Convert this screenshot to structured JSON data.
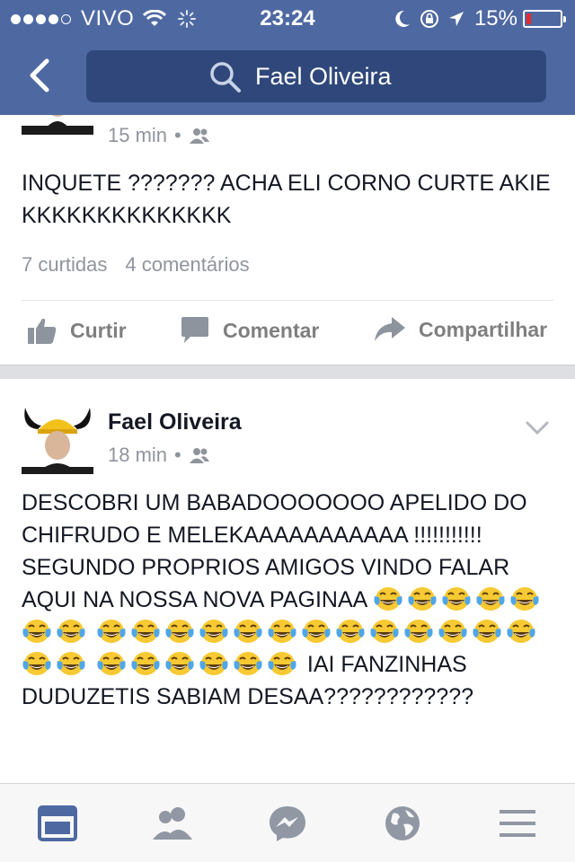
{
  "status_bar": {
    "carrier": "VIVO",
    "time": "23:24",
    "battery": "15%",
    "battery_level": 0.15,
    "signal_dots_filled": 4,
    "signal_dots_total": 5
  },
  "nav": {
    "search_value": "Fael Oliveira",
    "colors": {
      "bar": "#4e69a2",
      "search_bg": "#2f477a"
    }
  },
  "posts": [
    {
      "time": "15 min",
      "text": "INQUETE ??????? ACHA ELI CORNO CURTE AKIE KKKKKKKKKKKKKK",
      "likes": "7 curtidas",
      "comments": "4 comentários"
    },
    {
      "author": "Fael Oliveira",
      "time": "18 min",
      "text_part1": "DESCOBRI UM BABADOOOOOOO APELIDO DO CHIFRUDO E MELEKAAAAAAAAAAA !!!!!!!!!!! SEGUNDO PROPRIOS AMIGOS VINDO FALAR AQUI NA NOSSA NOVA PAGINAA",
      "emoji_run1_count": 7,
      "emoji_run2_count": 15,
      "emoji_run3_count": 6,
      "text_part2": "IAI FANZINHAS DUDUZETIS SABIAM DESAA????????????",
      "emoji_name": "face-with-tears-of-joy"
    }
  ],
  "actions": {
    "like": "Curtir",
    "comment": "Comentar",
    "share": "Compartilhar"
  },
  "tabs": [
    {
      "icon": "news-feed-icon",
      "active": true
    },
    {
      "icon": "friends-icon",
      "active": false
    },
    {
      "icon": "messenger-icon",
      "active": false
    },
    {
      "icon": "globe-notifications-icon",
      "active": false
    },
    {
      "icon": "menu-icon",
      "active": false
    }
  ]
}
